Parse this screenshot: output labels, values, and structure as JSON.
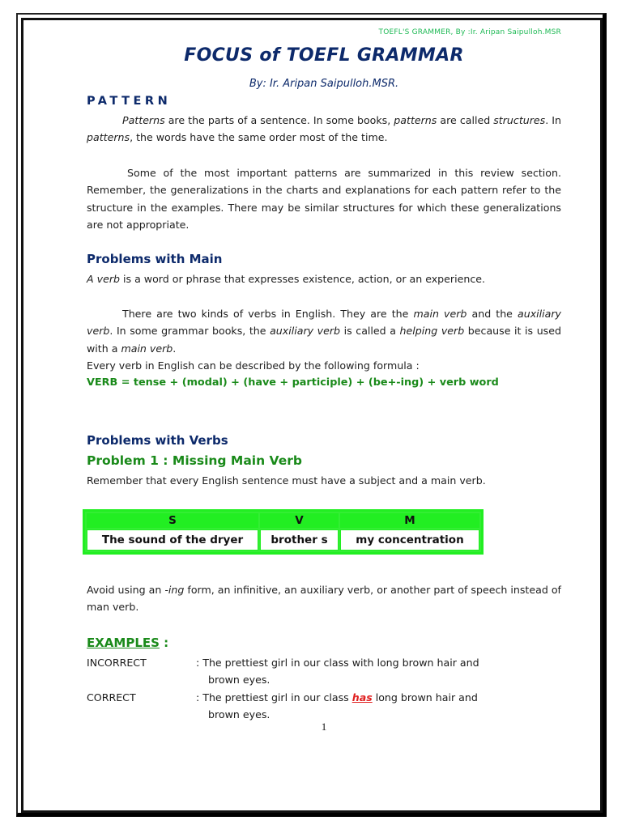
{
  "running_head": "TOEFL'S GRAMMER, By :Ir. Aripan Saipulloh.MSR",
  "title": "FOCUS of TOEFL GRAMMAR",
  "byline": "By: Ir. Aripan Saipulloh.MSR.",
  "pattern": {
    "heading": "PATTERN",
    "p1": {
      "t1": "Patterns",
      "t2": " are the parts of a sentence. In some books, ",
      "t3": "patterns",
      "t4": " are called ",
      "t5": "structures",
      "t6": ". In ",
      "t7": "patterns",
      "t8": ", the words have the same order most of the time."
    },
    "p2": "Some of the most important patterns are summarized in this review section. Remember, the generalizations in the charts and explanations for each pattern refer to the structure in the examples. There may be similar structures for which these generalizations are not appropriate."
  },
  "main": {
    "heading": "Problems with Main",
    "p1": {
      "t1": "A verb",
      "t2": " is a word or phrase that expresses existence, action, or an experience."
    },
    "p2": {
      "t1": "There are two kinds of verbs in English. They are the ",
      "t2": "main verb",
      "t3": " and the ",
      "t4": "auxiliary verb",
      "t5": ". In some grammar books, the ",
      "t6": "auxiliary verb",
      "t7": " is called a ",
      "t8": "helping verb",
      "t9": " because it is used with a ",
      "t10": "main verb",
      "t11": "."
    },
    "p3": "Every verb in English can be described by the following formula :",
    "formula": "VERB = tense + (modal) + (have + participle) + (be+-ing) + verb word"
  },
  "verbs": {
    "heading": "Problems with Verbs",
    "problem1_heading": "Problem 1 : Missing Main Verb",
    "p1": "Remember that every English sentence must have a subject and a main verb.",
    "table": {
      "headers": [
        "S",
        "V",
        "M"
      ],
      "row": [
        "The sound of the dryer",
        "brother s",
        "my concentration"
      ]
    },
    "p2": {
      "t1": "Avoid using an ",
      "t2": "-ing",
      "t3": " form, an infinitive, an auxiliary verb, or another part of speech instead of man verb."
    }
  },
  "examples": {
    "heading": "EXAMPLES",
    "colon": " :",
    "incorrect": {
      "label": "INCORRECT",
      "line1": ": The prettiest girl in our class with long brown hair and",
      "line2": "brown eyes."
    },
    "correct": {
      "label": "CORRECT",
      "pre": ": The prettiest girl in our class ",
      "highlight": "has",
      "post": " long brown hair and",
      "line2": "brown eyes."
    }
  },
  "page_number": "1",
  "colors": {
    "title_navy": "#0d2a6b",
    "accent_green": "#1a8a1a",
    "table_green": "#22ee22",
    "running_head_green": "#1db954",
    "highlight_red": "#e02020"
  }
}
